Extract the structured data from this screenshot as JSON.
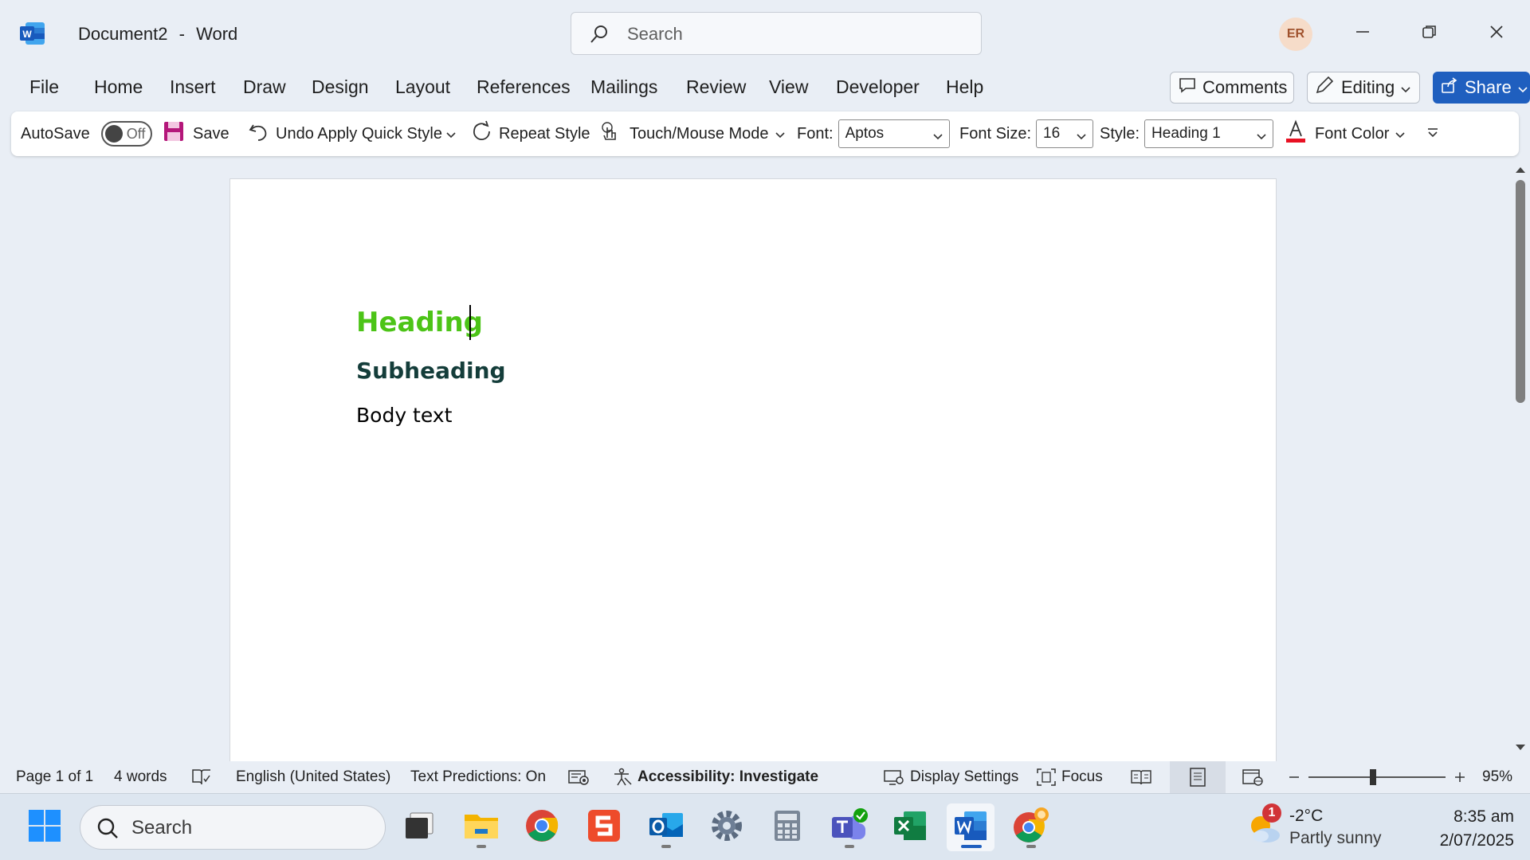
{
  "app": {
    "document_title": "Document2",
    "separator": "-",
    "app_name": "Word",
    "search_placeholder": "Search",
    "user_initials": "ER"
  },
  "menu": {
    "tabs": [
      "File",
      "Home",
      "Insert",
      "Draw",
      "Design",
      "Layout",
      "References",
      "Mailings",
      "Review",
      "View",
      "Developer",
      "Help"
    ],
    "comments_label": "Comments",
    "editing_label": "Editing",
    "share_label": "Share"
  },
  "quick_toolbar": {
    "autosave_label": "AutoSave",
    "autosave_state": "Off",
    "save_label": "Save",
    "undo_label": "Undo Apply Quick Style",
    "repeat_label": "Repeat Style",
    "touch_mode_label": "Touch/Mouse Mode",
    "font_label": "Font:",
    "font_value": "Aptos",
    "font_size_label": "Font Size:",
    "font_size_value": "16",
    "style_label": "Style:",
    "style_value": "Heading 1",
    "font_color_label": "Font Color"
  },
  "document": {
    "heading": "Heading",
    "subheading": "Subheading",
    "body": "Body text"
  },
  "statusbar": {
    "page": "Page 1 of 1",
    "words": "4 words",
    "language": "English (United States)",
    "text_predictions": "Text Predictions: On",
    "accessibility": "Accessibility: Investigate",
    "display_settings": "Display Settings",
    "focus": "Focus",
    "zoom": "95%",
    "zoom_level": 95
  },
  "taskbar": {
    "search_placeholder": "Search",
    "weather_badge": "1",
    "temperature": "-2°C",
    "condition": "Partly sunny",
    "time": "8:35 am",
    "date": "2/07/2025"
  },
  "colors": {
    "heading": "#4cc417",
    "subheading": "#143d3a",
    "accent": "#1f5fbf",
    "font_color_bar": "#e81123"
  }
}
